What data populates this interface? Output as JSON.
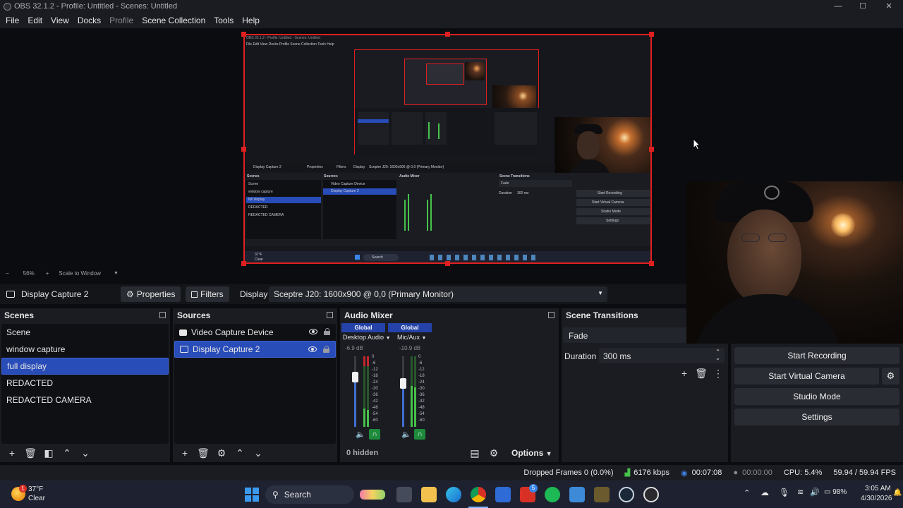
{
  "window": {
    "title": "OBS 32.1.2 - Profile: Untitled - Scenes: Untitled",
    "minimize": "—",
    "maximize": "☐",
    "close": "✕"
  },
  "menu": [
    "File",
    "Edit",
    "View",
    "Docks",
    "Profile",
    "Scene Collection",
    "Tools",
    "Help"
  ],
  "preview": {
    "nested_title": "OBS 32.1.2 - Profile: Untitled - Scenes: Untitled",
    "nested_menu": "File  Edit  View  Docks  Profile  Scene Collection  Tools  Help",
    "nested_source": "Display Capture 2",
    "nested_properties": "Properties",
    "nested_filters": "Filters",
    "nested_display": "Display",
    "nested_display_value": "Sceptre J20: 1600x900 @ 0,0 (Primary Monitor)",
    "nested_scenes_title": "Scenes",
    "nested_sources_title": "Sources",
    "nested_mixer_title": "Audio Mixer",
    "nested_transitions_title": "Scene Transitions",
    "nested_scenes": [
      "Scene",
      "window capture",
      "full display",
      "REDACTED",
      "REDACTED CAMERA"
    ],
    "nested_sources": [
      "Video Capture Device",
      "Display Capture 2"
    ],
    "nested_controls": [
      "Start Recording",
      "Start Virtual Camera",
      "Studio Mode",
      "Settings"
    ],
    "nested_fade": "Fade",
    "nested_duration": "Duration",
    "nested_duration_value": "300 ms",
    "nested_weather": "37°F",
    "nested_weather2": "Clear",
    "nested_search": "Search"
  },
  "zoom": {
    "minus": "−",
    "level": "56%",
    "plus": "+",
    "mode": "Scale to Window"
  },
  "source_toolbar": {
    "source_name": "Display Capture 2",
    "properties": "Properties",
    "filters": "Filters",
    "display_label": "Display",
    "display_value": "Sceptre J20: 1600x900 @ 0,0 (Primary Monitor)"
  },
  "scenes": {
    "title": "Scenes",
    "items": [
      "Scene",
      "window capture",
      "full display",
      "REDACTED",
      "REDACTED CAMERA"
    ],
    "selected": "full display"
  },
  "sources": {
    "title": "Sources",
    "items": [
      "Video Capture Device",
      "Display Capture 2"
    ],
    "selected": "Display Capture 2"
  },
  "mixer": {
    "title": "Audio Mixer",
    "channels": [
      {
        "head": "Global",
        "name": "Desktop Audio",
        "db": "-6.9 dB"
      },
      {
        "head": "Global",
        "name": "Mic/Aux",
        "db": "-10.9 dB"
      }
    ],
    "scale": [
      "0",
      "-6",
      "-12",
      "-18",
      "-24",
      "-30",
      "-36",
      "-42",
      "-48",
      "-54",
      "-60"
    ],
    "hidden": "0 hidden",
    "options": "Options"
  },
  "transitions": {
    "title": "Scene Transitions",
    "type": "Fade",
    "duration_label": "Duration",
    "duration_value": "300 ms"
  },
  "controls": {
    "start_recording": "Start Recording",
    "start_virtual_camera": "Start Virtual Camera",
    "studio_mode": "Studio Mode",
    "settings": "Settings"
  },
  "status": {
    "dropped_frames": "Dropped Frames 0 (0.0%)",
    "bitrate": "6176 kbps",
    "rec_time": "00:07:08",
    "stream_time": "00:00:00",
    "cpu": "CPU: 5.4%",
    "fps": "59.94 / 59.94 FPS"
  },
  "taskbar": {
    "weather_temp": "37°F",
    "weather_cond": "Clear",
    "weather_badge": "1",
    "search": "Search",
    "battery": "98%",
    "time": "3:05 AM",
    "date": "4/30/2026",
    "notif_badge": "5"
  },
  "colors": {
    "accent": "#284cb8",
    "preview_border": "#e02020",
    "meter_green": "#46c24a",
    "meter_red": "#c2282d"
  }
}
